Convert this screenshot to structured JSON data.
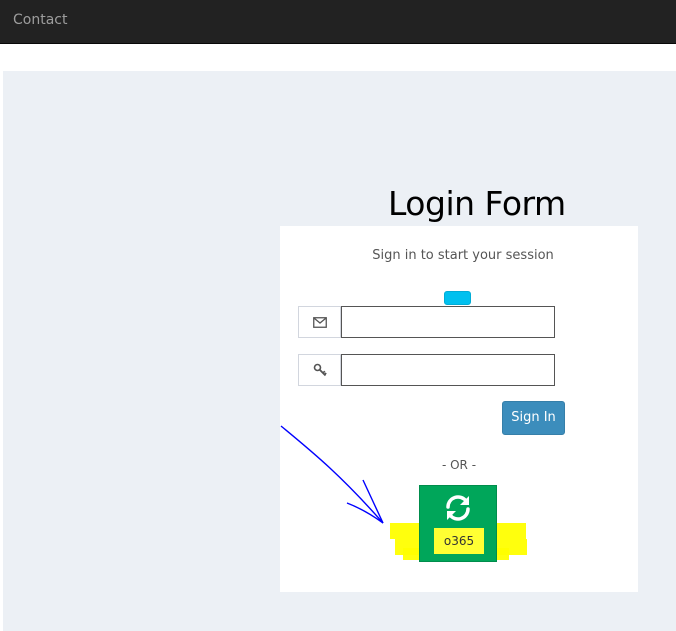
{
  "navbar": {
    "contact_label": "Contact"
  },
  "page": {
    "title": "Login Form"
  },
  "login": {
    "message": "Sign in to start your session",
    "email_value": "",
    "password_value": "",
    "email_icon": "envelope-icon",
    "password_icon": "key-icon",
    "signin_label": "Sign In",
    "or_text": "- OR -",
    "o365_icon": "refresh-icon",
    "o365_label": "o365"
  },
  "colors": {
    "navbar_bg": "#222222",
    "content_bg": "#ecf0f5",
    "primary": "#3c8dbc",
    "success": "#00a65a",
    "info": "#00c0ef",
    "highlight": "#ffff00",
    "annotation_pen": "#0000ff"
  }
}
